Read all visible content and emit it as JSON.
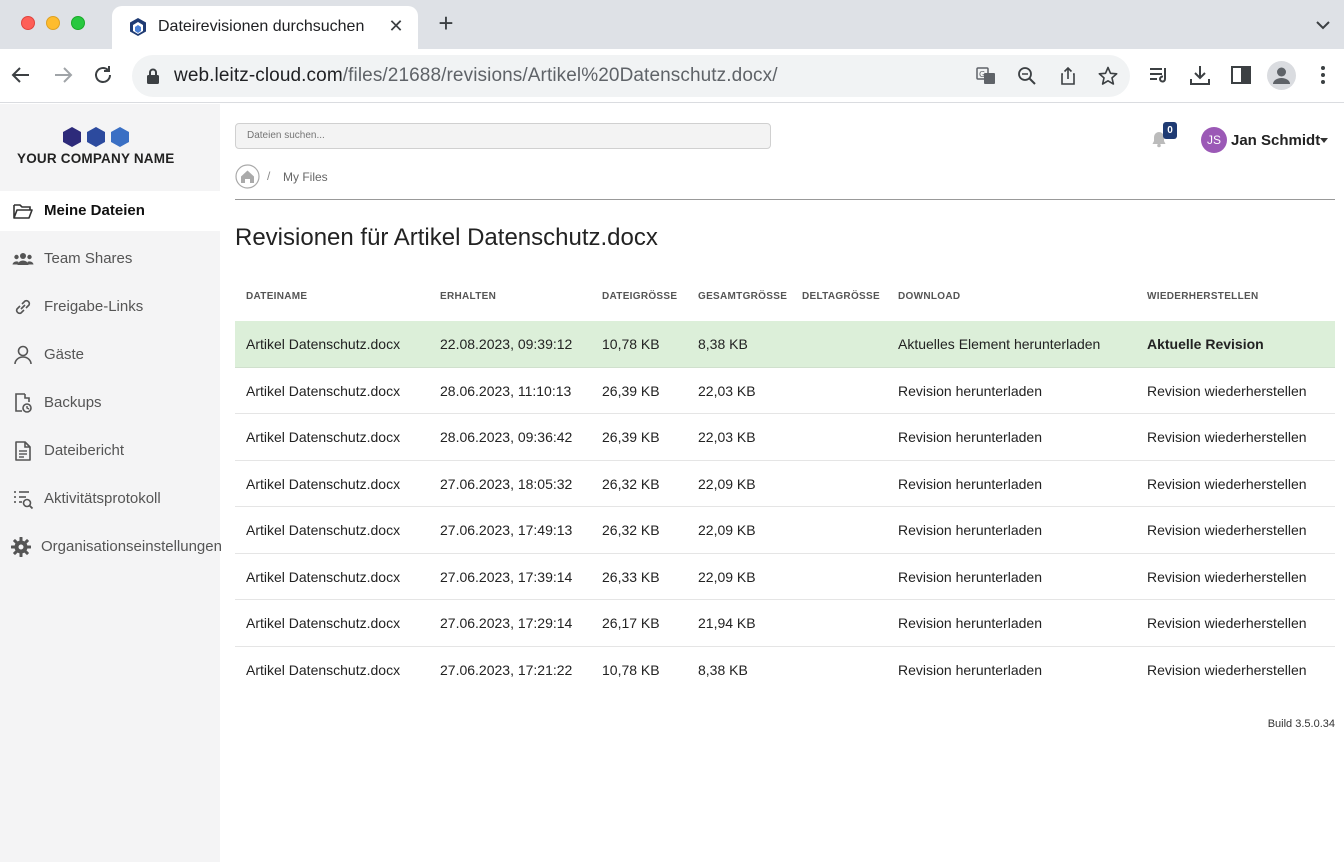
{
  "browser": {
    "tab_title": "Dateirevisionen durchsuchen",
    "url_host": "web.leitz-cloud.com",
    "url_path": "/files/21688/revisions/Artikel%20Datenschutz.docx/"
  },
  "sidebar": {
    "logo_text": "YOUR COMPANY NAME",
    "logo_colors": [
      "#2d2a7a",
      "#2c4a9e",
      "#3a6fc4"
    ],
    "items": [
      {
        "label": "Meine Dateien",
        "icon": "folder-open-icon",
        "active": true
      },
      {
        "label": "Team Shares",
        "icon": "users-icon",
        "active": false
      },
      {
        "label": "Freigabe-Links",
        "icon": "link-icon",
        "active": false
      },
      {
        "label": "Gäste",
        "icon": "user-icon",
        "active": false
      },
      {
        "label": "Backups",
        "icon": "backup-icon",
        "active": false
      },
      {
        "label": "Dateibericht",
        "icon": "report-icon",
        "active": false
      },
      {
        "label": "Aktivitätsprotokoll",
        "icon": "activity-log-icon",
        "active": false
      },
      {
        "label": "Organisationseinstellungen",
        "icon": "gear-icon",
        "active": false
      }
    ]
  },
  "header": {
    "search_placeholder": "Dateien suchen...",
    "notification_count": "0",
    "user_initials": "JS",
    "user_name": "Jan Schmidt",
    "avatar_color": "#9b59b6"
  },
  "breadcrumb": {
    "separator": "/",
    "current": "My Files"
  },
  "page_title": "Revisionen für Artikel Datenschutz.docx",
  "table": {
    "headers": [
      "DATEINAME",
      "ERHALTEN",
      "DATEIGRÖSSE",
      "GESAMTGRÖSSE",
      "DELTAGRÖSSE",
      "DOWNLOAD",
      "WIEDERHERSTELLEN"
    ],
    "rows": [
      {
        "name": "Artikel Datenschutz.docx",
        "received": "22.08.2023, 09:39:12",
        "size": "10,78 KB",
        "total": "8,38 KB",
        "delta": "",
        "download": "Aktuelles Element herunterladen",
        "restore": "Aktuelle Revision",
        "current": true
      },
      {
        "name": "Artikel Datenschutz.docx",
        "received": "28.06.2023, 11:10:13",
        "size": "26,39 KB",
        "total": "22,03 KB",
        "delta": "",
        "download": "Revision herunterladen",
        "restore": "Revision wiederherstellen",
        "current": false
      },
      {
        "name": "Artikel Datenschutz.docx",
        "received": "28.06.2023, 09:36:42",
        "size": "26,39 KB",
        "total": "22,03 KB",
        "delta": "",
        "download": "Revision herunterladen",
        "restore": "Revision wiederherstellen",
        "current": false
      },
      {
        "name": "Artikel Datenschutz.docx",
        "received": "27.06.2023, 18:05:32",
        "size": "26,32 KB",
        "total": "22,09 KB",
        "delta": "",
        "download": "Revision herunterladen",
        "restore": "Revision wiederherstellen",
        "current": false
      },
      {
        "name": "Artikel Datenschutz.docx",
        "received": "27.06.2023, 17:49:13",
        "size": "26,32 KB",
        "total": "22,09 KB",
        "delta": "",
        "download": "Revision herunterladen",
        "restore": "Revision wiederherstellen",
        "current": false
      },
      {
        "name": "Artikel Datenschutz.docx",
        "received": "27.06.2023, 17:39:14",
        "size": "26,33 KB",
        "total": "22,09 KB",
        "delta": "",
        "download": "Revision herunterladen",
        "restore": "Revision wiederherstellen",
        "current": false
      },
      {
        "name": "Artikel Datenschutz.docx",
        "received": "27.06.2023, 17:29:14",
        "size": "26,17 KB",
        "total": "21,94 KB",
        "delta": "",
        "download": "Revision herunterladen",
        "restore": "Revision wiederherstellen",
        "current": false
      },
      {
        "name": "Artikel Datenschutz.docx",
        "received": "27.06.2023, 17:21:22",
        "size": "10,78 KB",
        "total": "8,38 KB",
        "delta": "",
        "download": "Revision herunterladen",
        "restore": "Revision wiederherstellen",
        "current": false
      }
    ]
  },
  "footer": {
    "build": "Build 3.5.0.34"
  }
}
